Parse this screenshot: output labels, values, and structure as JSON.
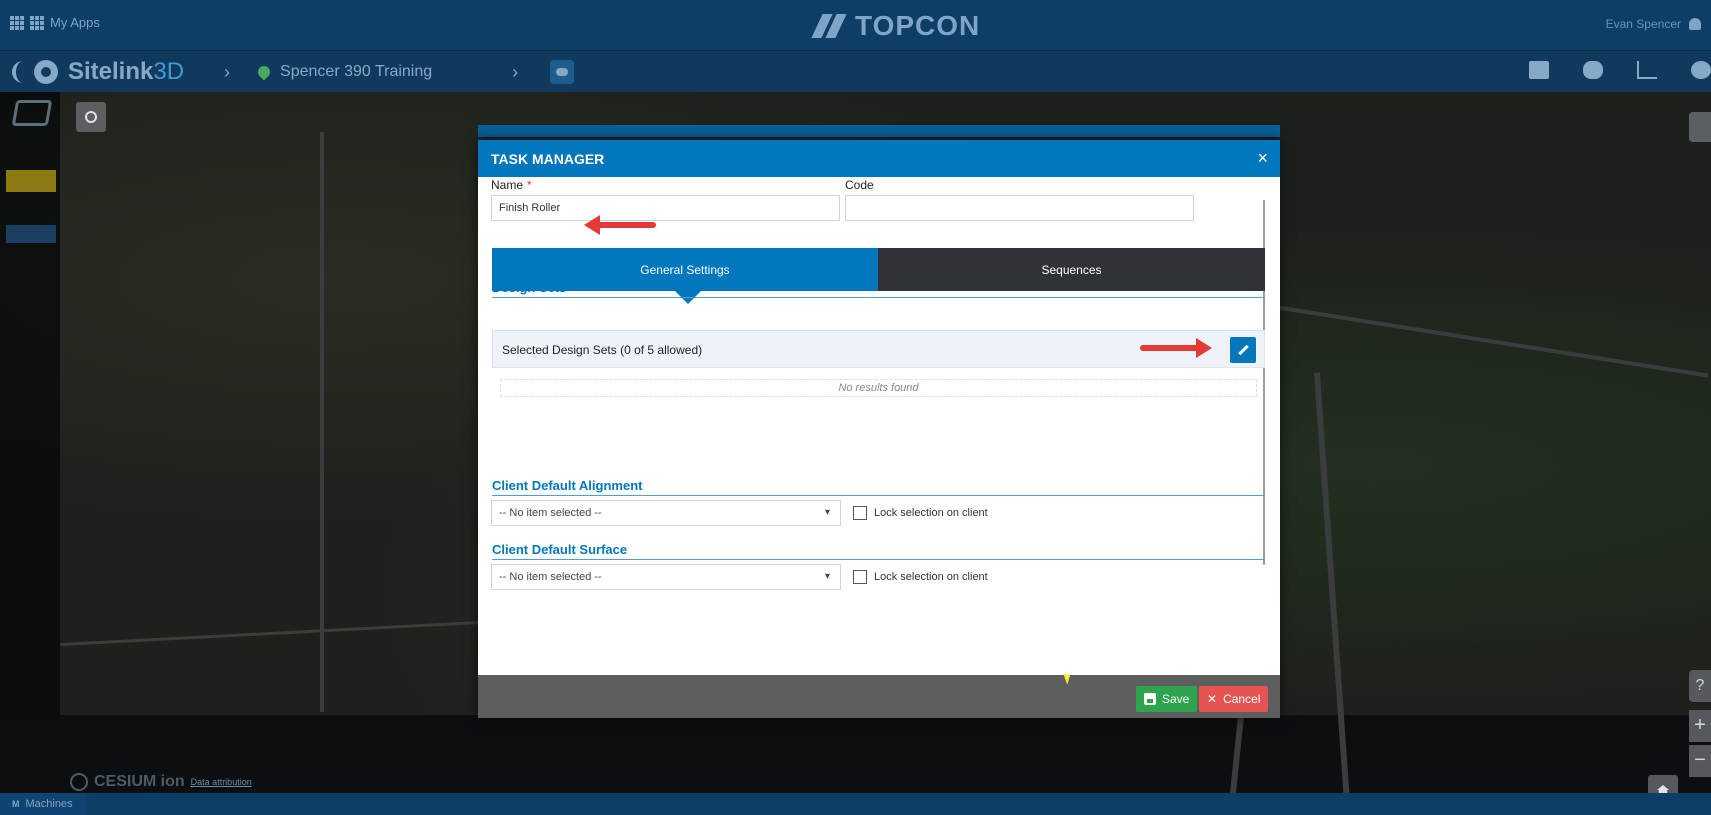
{
  "topbar": {
    "apps_label": "My Apps",
    "brand_logo": "TOPCON",
    "user_name": "Evan Spencer"
  },
  "navbar": {
    "brand_bold": "Sitelink",
    "brand_light": "3D",
    "project_name": "Spencer 390 Training",
    "icons": [
      "folder-icon",
      "database-icon",
      "chart-icon",
      "settings-icon"
    ]
  },
  "map": {
    "attribution_logo": "CESIUM ion",
    "attribution_link": "Data attribution"
  },
  "bottombar": {
    "tab_icon_letter": "M",
    "tab_label": "Machines"
  },
  "modal": {
    "title": "TASK MANAGER",
    "close_glyph": "×",
    "name_label": "Name",
    "required_mark": "*",
    "name_value": "Finish Roller",
    "code_label": "Code",
    "code_value": "",
    "tabs": [
      {
        "label": "General Settings",
        "active": true
      },
      {
        "label": "Sequences",
        "active": false
      }
    ],
    "design_sets": {
      "title": "Design Sets",
      "selected_label": "Selected Design Sets (0 of 5 allowed)",
      "empty_text": "No results found"
    },
    "alignment": {
      "title": "Client Default Alignment",
      "select_value": "-- No item selected --",
      "lock_label": "Lock selection on client"
    },
    "surface": {
      "title": "Client Default Surface",
      "select_value": "-- No item selected --",
      "lock_label": "Lock selection on client"
    },
    "footer": {
      "save_label": "Save",
      "cancel_label": "Cancel",
      "cancel_glyph": "✕"
    }
  },
  "colors": {
    "primary": "#0277bd",
    "header_bar": "#0d3e66",
    "tab_inactive": "#2f3337",
    "save": "#2ea44f",
    "cancel": "#e55353",
    "annotation_arrow": "#e53935"
  }
}
